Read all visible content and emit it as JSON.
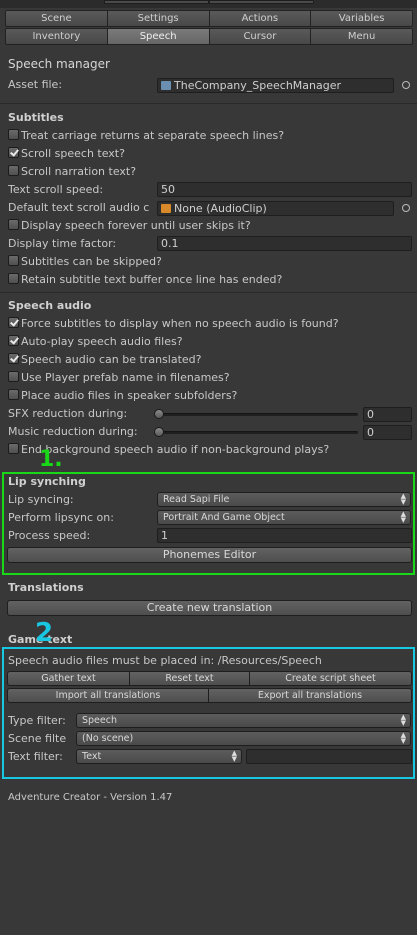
{
  "tabs": {
    "row1": [
      "Scene",
      "Settings",
      "Actions",
      "Variables"
    ],
    "row2": [
      "Inventory",
      "Speech",
      "Cursor",
      "Menu"
    ],
    "active": "Speech"
  },
  "speech_manager": {
    "title": "Speech manager",
    "asset_label": "Asset file:",
    "asset_value": "TheCompany_SpeechManager"
  },
  "subtitles": {
    "title": "Subtitles",
    "carriage": "Treat carriage returns at separate speech lines?",
    "scroll_speech": "Scroll speech text?",
    "scroll_narration": "Scroll narration text?",
    "text_scroll_speed_label": "Text scroll speed:",
    "text_scroll_speed_value": "50",
    "default_audio_label": "Default text scroll audio c",
    "default_audio_value": "None (AudioClip)",
    "display_forever": "Display speech forever until user skips it?",
    "display_time_label": "Display time factor:",
    "display_time_value": "0.1",
    "can_skip": "Subtitles can be skipped?",
    "retain_buffer": "Retain subtitle text buffer once line has ended?"
  },
  "speech_audio": {
    "title": "Speech audio",
    "force_subtitles": "Force subtitles to display when no speech audio is found?",
    "auto_play": "Auto-play speech audio files?",
    "can_translate": "Speech audio can be translated?",
    "use_prefab": "Use Player prefab name in filenames?",
    "place_subfolders": "Place audio files in speaker subfolders?",
    "sfx_label": "SFX reduction during:",
    "sfx_value": "0",
    "music_label": "Music reduction during:",
    "music_value": "0",
    "end_background": "End background speech audio if non-background plays?"
  },
  "lip_synching": {
    "title": "Lip synching",
    "lip_syncing_label": "Lip syncing:",
    "lip_syncing_value": "Read Sapi File",
    "perform_label": "Perform lipsync on:",
    "perform_value": "Portrait And Game Object",
    "process_label": "Process speed:",
    "process_value": "1",
    "phonemes_button": "Phonemes Editor"
  },
  "translations": {
    "title": "Translations",
    "create_button": "Create new translation"
  },
  "game_text": {
    "title": "Game text",
    "path_text": "Speech audio files must be placed in: /Resources/Speech",
    "gather_button": "Gather text",
    "reset_button": "Reset text",
    "script_button": "Create script sheet",
    "import_button": "Import all translations",
    "export_button": "Export all translations",
    "type_filter_label": "Type filter:",
    "type_filter_value": "Speech",
    "scene_filter_label": "Scene filte",
    "scene_filter_value": "(No scene)",
    "text_filter_label": "Text filter:",
    "text_filter_value": "Text",
    "text_filter_input": ""
  },
  "footer": {
    "version": "Adventure Creator - Version 1.47"
  },
  "annotations": {
    "green_number": "1.",
    "cyan_number": "2"
  },
  "colors": {
    "green_highlight": "#18d818",
    "cyan_highlight": "#18c8e0",
    "background": "#383838"
  }
}
